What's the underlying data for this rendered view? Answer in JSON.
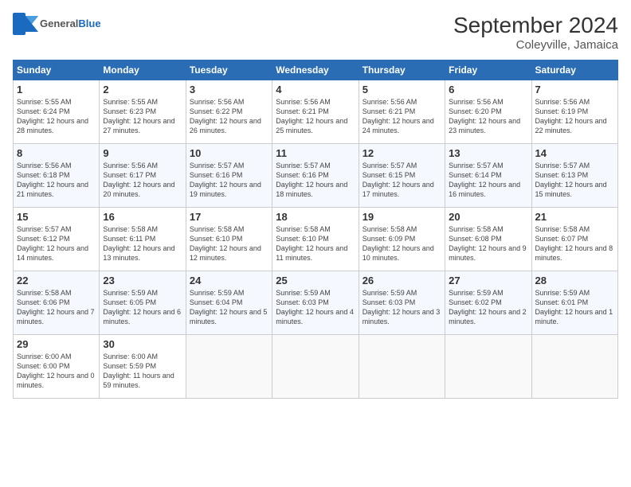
{
  "header": {
    "logo_general": "General",
    "logo_blue": "Blue",
    "title": "September 2024",
    "subtitle": "Coleyville, Jamaica"
  },
  "days_of_week": [
    "Sunday",
    "Monday",
    "Tuesday",
    "Wednesday",
    "Thursday",
    "Friday",
    "Saturday"
  ],
  "weeks": [
    [
      {
        "day": "1",
        "sunrise": "Sunrise: 5:55 AM",
        "sunset": "Sunset: 6:24 PM",
        "daylight": "Daylight: 12 hours and 28 minutes."
      },
      {
        "day": "2",
        "sunrise": "Sunrise: 5:55 AM",
        "sunset": "Sunset: 6:23 PM",
        "daylight": "Daylight: 12 hours and 27 minutes."
      },
      {
        "day": "3",
        "sunrise": "Sunrise: 5:56 AM",
        "sunset": "Sunset: 6:22 PM",
        "daylight": "Daylight: 12 hours and 26 minutes."
      },
      {
        "day": "4",
        "sunrise": "Sunrise: 5:56 AM",
        "sunset": "Sunset: 6:21 PM",
        "daylight": "Daylight: 12 hours and 25 minutes."
      },
      {
        "day": "5",
        "sunrise": "Sunrise: 5:56 AM",
        "sunset": "Sunset: 6:21 PM",
        "daylight": "Daylight: 12 hours and 24 minutes."
      },
      {
        "day": "6",
        "sunrise": "Sunrise: 5:56 AM",
        "sunset": "Sunset: 6:20 PM",
        "daylight": "Daylight: 12 hours and 23 minutes."
      },
      {
        "day": "7",
        "sunrise": "Sunrise: 5:56 AM",
        "sunset": "Sunset: 6:19 PM",
        "daylight": "Daylight: 12 hours and 22 minutes."
      }
    ],
    [
      {
        "day": "8",
        "sunrise": "Sunrise: 5:56 AM",
        "sunset": "Sunset: 6:18 PM",
        "daylight": "Daylight: 12 hours and 21 minutes."
      },
      {
        "day": "9",
        "sunrise": "Sunrise: 5:56 AM",
        "sunset": "Sunset: 6:17 PM",
        "daylight": "Daylight: 12 hours and 20 minutes."
      },
      {
        "day": "10",
        "sunrise": "Sunrise: 5:57 AM",
        "sunset": "Sunset: 6:16 PM",
        "daylight": "Daylight: 12 hours and 19 minutes."
      },
      {
        "day": "11",
        "sunrise": "Sunrise: 5:57 AM",
        "sunset": "Sunset: 6:16 PM",
        "daylight": "Daylight: 12 hours and 18 minutes."
      },
      {
        "day": "12",
        "sunrise": "Sunrise: 5:57 AM",
        "sunset": "Sunset: 6:15 PM",
        "daylight": "Daylight: 12 hours and 17 minutes."
      },
      {
        "day": "13",
        "sunrise": "Sunrise: 5:57 AM",
        "sunset": "Sunset: 6:14 PM",
        "daylight": "Daylight: 12 hours and 16 minutes."
      },
      {
        "day": "14",
        "sunrise": "Sunrise: 5:57 AM",
        "sunset": "Sunset: 6:13 PM",
        "daylight": "Daylight: 12 hours and 15 minutes."
      }
    ],
    [
      {
        "day": "15",
        "sunrise": "Sunrise: 5:57 AM",
        "sunset": "Sunset: 6:12 PM",
        "daylight": "Daylight: 12 hours and 14 minutes."
      },
      {
        "day": "16",
        "sunrise": "Sunrise: 5:58 AM",
        "sunset": "Sunset: 6:11 PM",
        "daylight": "Daylight: 12 hours and 13 minutes."
      },
      {
        "day": "17",
        "sunrise": "Sunrise: 5:58 AM",
        "sunset": "Sunset: 6:10 PM",
        "daylight": "Daylight: 12 hours and 12 minutes."
      },
      {
        "day": "18",
        "sunrise": "Sunrise: 5:58 AM",
        "sunset": "Sunset: 6:10 PM",
        "daylight": "Daylight: 12 hours and 11 minutes."
      },
      {
        "day": "19",
        "sunrise": "Sunrise: 5:58 AM",
        "sunset": "Sunset: 6:09 PM",
        "daylight": "Daylight: 12 hours and 10 minutes."
      },
      {
        "day": "20",
        "sunrise": "Sunrise: 5:58 AM",
        "sunset": "Sunset: 6:08 PM",
        "daylight": "Daylight: 12 hours and 9 minutes."
      },
      {
        "day": "21",
        "sunrise": "Sunrise: 5:58 AM",
        "sunset": "Sunset: 6:07 PM",
        "daylight": "Daylight: 12 hours and 8 minutes."
      }
    ],
    [
      {
        "day": "22",
        "sunrise": "Sunrise: 5:58 AM",
        "sunset": "Sunset: 6:06 PM",
        "daylight": "Daylight: 12 hours and 7 minutes."
      },
      {
        "day": "23",
        "sunrise": "Sunrise: 5:59 AM",
        "sunset": "Sunset: 6:05 PM",
        "daylight": "Daylight: 12 hours and 6 minutes."
      },
      {
        "day": "24",
        "sunrise": "Sunrise: 5:59 AM",
        "sunset": "Sunset: 6:04 PM",
        "daylight": "Daylight: 12 hours and 5 minutes."
      },
      {
        "day": "25",
        "sunrise": "Sunrise: 5:59 AM",
        "sunset": "Sunset: 6:03 PM",
        "daylight": "Daylight: 12 hours and 4 minutes."
      },
      {
        "day": "26",
        "sunrise": "Sunrise: 5:59 AM",
        "sunset": "Sunset: 6:03 PM",
        "daylight": "Daylight: 12 hours and 3 minutes."
      },
      {
        "day": "27",
        "sunrise": "Sunrise: 5:59 AM",
        "sunset": "Sunset: 6:02 PM",
        "daylight": "Daylight: 12 hours and 2 minutes."
      },
      {
        "day": "28",
        "sunrise": "Sunrise: 5:59 AM",
        "sunset": "Sunset: 6:01 PM",
        "daylight": "Daylight: 12 hours and 1 minute."
      }
    ],
    [
      {
        "day": "29",
        "sunrise": "Sunrise: 6:00 AM",
        "sunset": "Sunset: 6:00 PM",
        "daylight": "Daylight: 12 hours and 0 minutes."
      },
      {
        "day": "30",
        "sunrise": "Sunrise: 6:00 AM",
        "sunset": "Sunset: 5:59 PM",
        "daylight": "Daylight: 11 hours and 59 minutes."
      },
      null,
      null,
      null,
      null,
      null
    ]
  ]
}
